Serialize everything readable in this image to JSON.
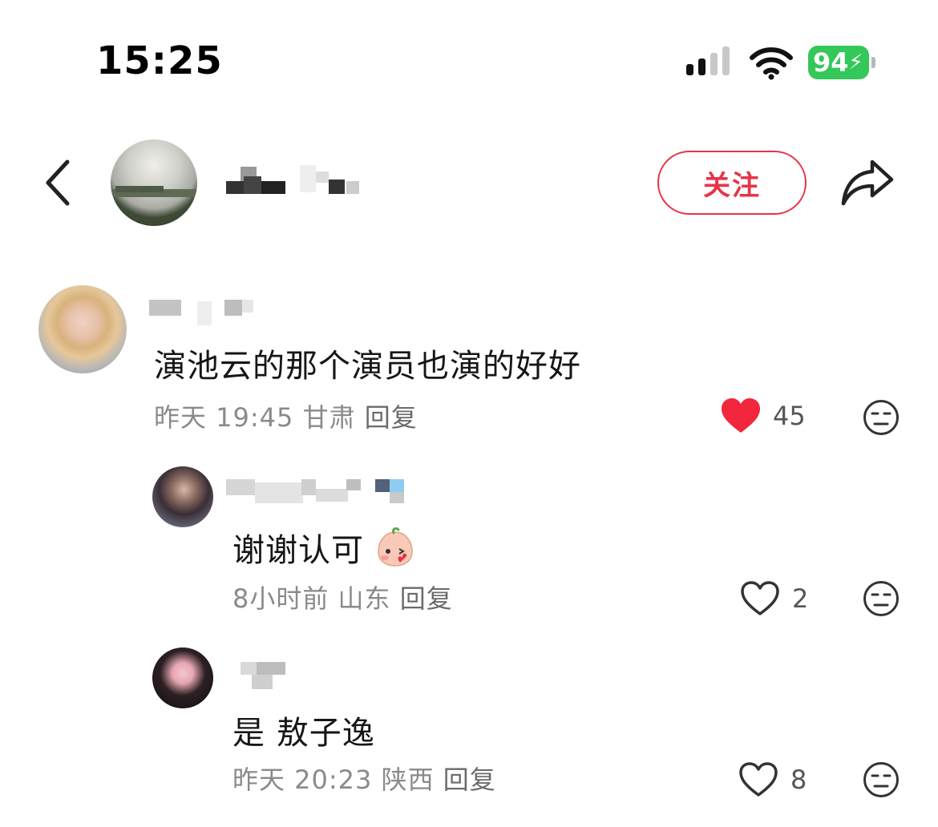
{
  "status_bar": {
    "time": "15:25",
    "battery": "94"
  },
  "header": {
    "follow_label": "关注"
  },
  "comments": [
    {
      "text": "演池云的那个演员也演的好好",
      "time": "昨天 19:45",
      "location": "甘肃",
      "reply_label": "回复",
      "likes": "45",
      "liked": true
    },
    {
      "text": "谢谢认可",
      "time": "8小时前",
      "location": "山东",
      "reply_label": "回复",
      "likes": "2",
      "liked": false
    },
    {
      "text": "是 敖子逸",
      "time": "昨天 20:23",
      "location": "陕西",
      "reply_label": "回复",
      "likes": "8",
      "liked": false
    }
  ],
  "colors": {
    "accent": "#e5354a",
    "like": "#f2273d",
    "battery": "#34c759",
    "meta": "#8a8a8a"
  },
  "icons": [
    "back-icon",
    "share-icon",
    "heart-icon",
    "emoji-icon",
    "signal-icon",
    "wifi-icon",
    "battery-icon"
  ]
}
